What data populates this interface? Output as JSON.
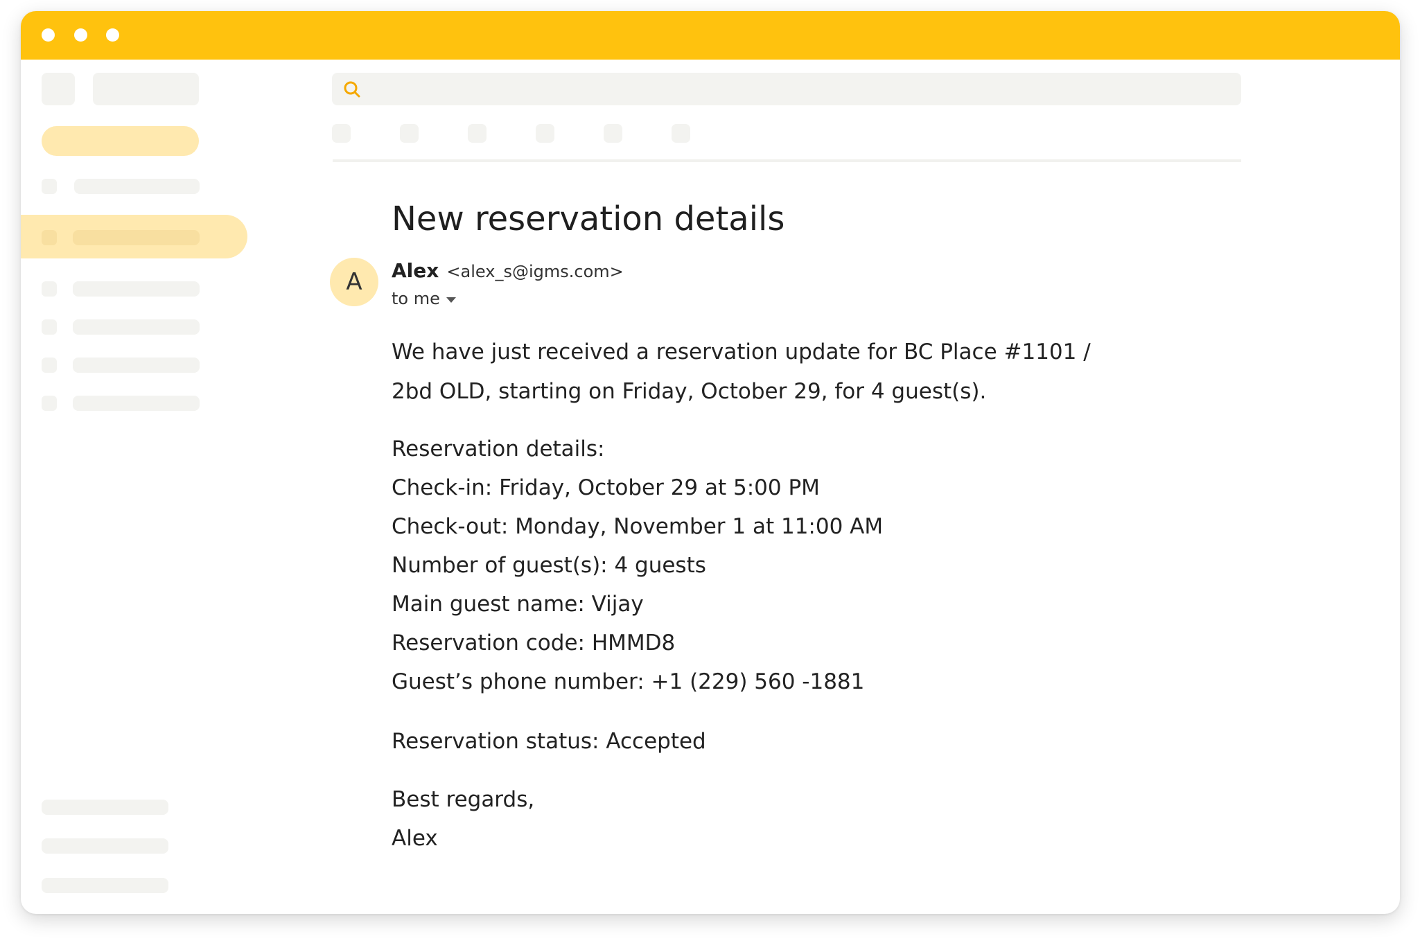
{
  "colors": {
    "accent": "#FFC20E",
    "accent_light": "#FFE9AF",
    "placeholder": "#F3F3F0",
    "text": "#222222"
  },
  "icons": {
    "search": "search-icon",
    "window_controls": [
      "window-dot-icon",
      "window-dot-icon",
      "window-dot-icon"
    ]
  },
  "email": {
    "subject": "New reservation details",
    "avatar_letter": "A",
    "sender_name": "Alex",
    "sender_email": "<alex_s@igms.com>",
    "recipient": "to me",
    "intro_line_1": "We have just received a reservation update for BC Place #1101 /",
    "intro_line_2": "2bd OLD, starting on Friday, October 29, for 4 guest(s).",
    "details": [
      "Reservation details:",
      "Check-in: Friday, October 29 at 5:00 PM",
      "Check-out: Monday, November 1 at 11:00 AM",
      "Number of guest(s):  4 guests",
      "Main guest name: Vijay",
      "Reservation code: HMMD8",
      "Guest’s phone number: +1 (229) 560 -1881"
    ],
    "status": "Reservation status: Accepted",
    "closing": "Best regards,",
    "signature": "Alex"
  }
}
